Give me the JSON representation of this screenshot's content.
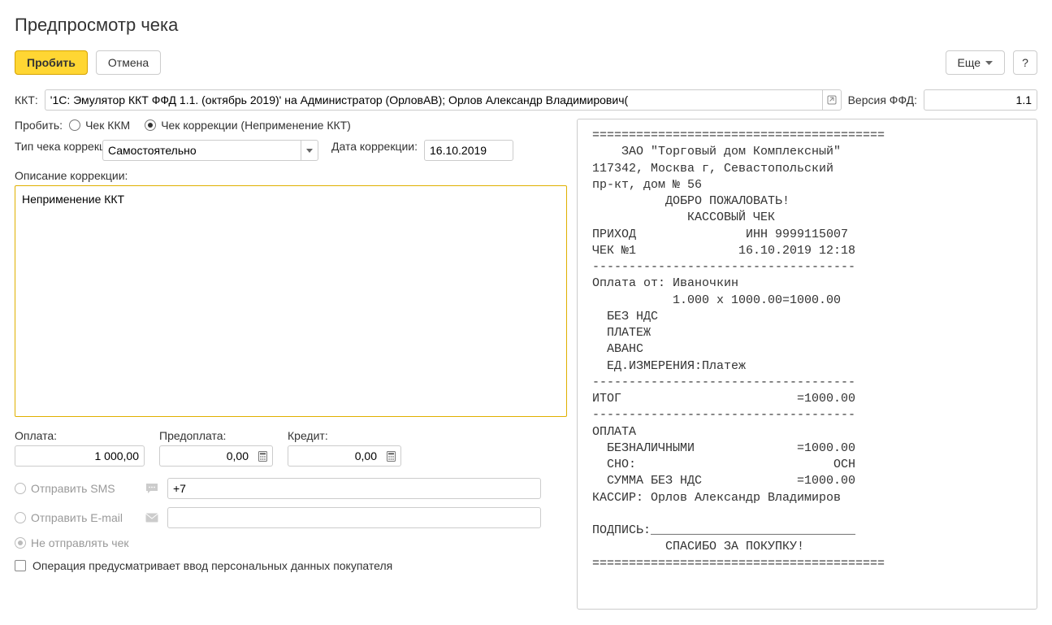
{
  "window": {
    "title": "Предпросмотр чека"
  },
  "toolbar": {
    "primary_label": "Пробить",
    "cancel_label": "Отмена",
    "more_label": "Еще",
    "help_label": "?"
  },
  "kkt": {
    "label": "ККТ:",
    "value": "'1С: Эмулятор ККТ ФФД 1.1. (октябрь 2019)' на Администратор (ОрловАВ); Орлов Александр Владимирович(",
    "version_label": "Версия ФФД:",
    "version_value": "1.1"
  },
  "punch": {
    "label": "Пробить:",
    "option_kkm": "Чек ККМ",
    "option_corr": "Чек коррекции (Неприменение ККТ)"
  },
  "correction": {
    "type_label": "Тип чека коррекции:",
    "type_value": "Самостоятельно",
    "date_label": "Дата коррекции:",
    "date_value": "16.10.2019",
    "desc_label": "Описание коррекции:",
    "desc_value": "Неприменение ККТ"
  },
  "amounts": {
    "pay_label": "Оплата:",
    "pay_value": "1 000,00",
    "prepay_label": "Предоплата:",
    "prepay_value": "0,00",
    "credit_label": "Кредит:",
    "credit_value": "0,00"
  },
  "send": {
    "sms_label": "Отправить SMS",
    "sms_value": "+7",
    "email_label": "Отправить E-mail",
    "email_value": "",
    "none_label": "Не отправлять чек"
  },
  "personal": {
    "label": "Операция предусматривает ввод персональных данных покупателя"
  },
  "receipt_text": "========================================\n    ЗАО \"Торговый дом Комплексный\"\n117342, Москва г, Севастопольский\nпр-кт, дом № 56\n          ДОБРО ПОЖАЛОВАТЬ!\n             КАССОВЫЙ ЧЕК\nПРИХОД               ИНН 9999115007\nЧЕК №1              16.10.2019 12:18\n------------------------------------\nОплата от: Иваночкин\n           1.000 x 1000.00=1000.00\n  БЕЗ НДС\n  ПЛАТЕЖ\n  АВАНС\n  ЕД.ИЗМЕРЕНИЯ:Платеж\n------------------------------------\nИТОГ                        =1000.00\n------------------------------------\nОПЛАТА\n  БЕЗНАЛИЧНЫМИ              =1000.00\n  СНО:                           ОСН\n  СУММА БЕЗ НДС             =1000.00\nКАССИР: Орлов Александр Владимиров\n\nПОДПИСЬ:____________________________\n          СПАСИБО ЗА ПОКУПКУ!\n========================================"
}
